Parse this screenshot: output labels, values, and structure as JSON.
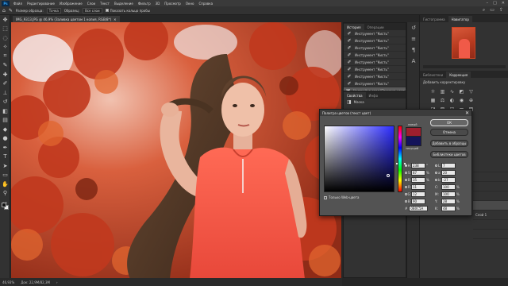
{
  "app": {
    "logo": "Ps",
    "menus": [
      "Файл",
      "Редактирование",
      "Изображение",
      "Слои",
      "Текст",
      "Выделение",
      "Фильтр",
      "3D",
      "Просмотр",
      "Окно",
      "Справка"
    ]
  },
  "options_bar": {
    "sample_size_label": "Размер образца:",
    "sample_size_value": "Точка",
    "sample_label": "Образец:",
    "sample_value": "Все слои",
    "show_ring_label": "Показать кольцо пробы"
  },
  "document": {
    "tab_title": "IMG_9313.JPG @ 46,9% (Заливка цветом 1 копия, RGB/8*)"
  },
  "statusbar": {
    "zoom": "46,93%",
    "doc_size": "Док: 22,9М/82,3М"
  },
  "history": {
    "tabs": [
      "История",
      "Операции"
    ],
    "rows": [
      "Инструмент \"Кисть\"",
      "Инструмент \"Кисть\"",
      "Инструмент \"Кисть\"",
      "Инструмент \"Кисть\"",
      "Инструмент \"Кисть\"",
      "Инструмент \"Кисть\"",
      "Инструмент \"Кисть\"",
      "Инструмент \"Кисть\"",
      "Настройка слоя \"Заливка цвет..."
    ]
  },
  "properties": {
    "tabs": [
      "Свойства",
      "Инфо"
    ],
    "row_label": "Маска"
  },
  "navigator": {
    "tabs": [
      "Гистограмма",
      "Навигатор"
    ]
  },
  "adjustments": {
    "tabs": [
      "Библиотеки",
      "Коррекция"
    ],
    "title": "Добавить корректировку"
  },
  "layers": {
    "rows": [
      "",
      "",
      "",
      "",
      "",
      "Слой 1",
      "",
      ""
    ]
  },
  "color_picker": {
    "title": "Палитра цветов (текст цвет)",
    "new_label": "новый",
    "current_label": "текущий",
    "ok_label": "ОК",
    "cancel_label": "Отмена",
    "add_swatches_label": "Добавить в образцы",
    "libraries_label": "Библиотеки цветов",
    "web_only_label": "Только Web-цвета",
    "new_color": "#9d1f2e",
    "current_color": "#14145a",
    "hsb": [
      {
        "label": "H:",
        "value": "238",
        "unit": "°"
      },
      {
        "label": "S:",
        "value": "87",
        "unit": "%"
      },
      {
        "label": "B:",
        "value": "35",
        "unit": "%"
      }
    ],
    "rgb": [
      {
        "label": "R:",
        "value": "11",
        "unit": ""
      },
      {
        "label": "G:",
        "value": "12",
        "unit": ""
      },
      {
        "label": "B:",
        "value": "90",
        "unit": ""
      }
    ],
    "lab": [
      {
        "label": "L:",
        "value": "7",
        "unit": ""
      },
      {
        "label": "a:",
        "value": "20",
        "unit": ""
      },
      {
        "label": "b:",
        "value": "-27",
        "unit": ""
      }
    ],
    "cmyk": [
      {
        "label": "C:",
        "value": "100",
        "unit": "%"
      },
      {
        "label": "M:",
        "value": "100",
        "unit": "%"
      },
      {
        "label": "Y:",
        "value": "28",
        "unit": "%"
      },
      {
        "label": "K:",
        "value": "48",
        "unit": "%"
      }
    ],
    "hex_label": "#",
    "hex": "0B0C5A"
  },
  "icons": {
    "tools": [
      "move",
      "marquee",
      "lasso",
      "quick-select",
      "crop",
      "eyedropper",
      "healing",
      "brush",
      "stamp",
      "history-brush",
      "eraser",
      "gradient",
      "blur",
      "dodge",
      "pen",
      "type",
      "path-select",
      "shape",
      "hand",
      "zoom",
      "more"
    ]
  }
}
